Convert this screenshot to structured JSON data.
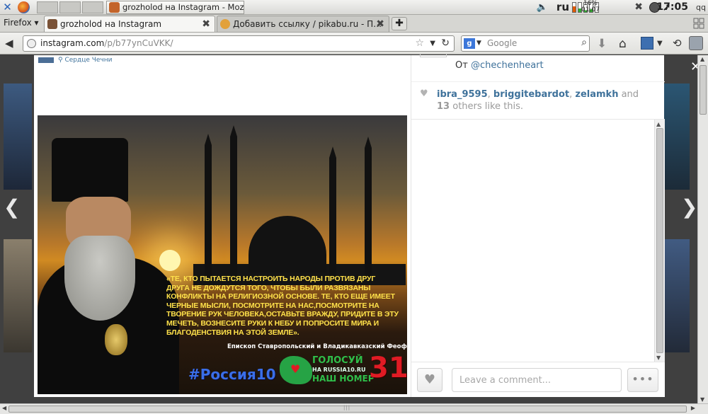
{
  "taskbar": {
    "active_task_title": "grozholod на Instagram - Mozi…",
    "keyboard_layout": "ru",
    "battery_percent": "16%",
    "battery_time": "01:07",
    "clock": "17:05",
    "user_label": "qq"
  },
  "browser": {
    "menu_label": "Firefox",
    "tabs": [
      {
        "title": "grozholod на Instagram",
        "active": true
      },
      {
        "title": "Добавить ссылку / pikabu.ru - П…",
        "active": false
      }
    ],
    "url_host": "instagram.com",
    "url_path": "/p/b77ynCuVKK/",
    "search_placeholder": "Google",
    "search_engine_icon": "google-icon"
  },
  "post": {
    "location": "Сердце Чечни",
    "image": {
      "quote": "«Те, кто пытается настроить народы против друг друга не дождутся того, чтобы были развязаны конфликты на религиозной основе. Те, кто еще имеет черные мысли, посмотрите на нас,посмотрите на творение рук человека,оставьте вражду, придите в эту мечеть, вознесите руки к небу и попросите мира и благоденствия на этой земле».",
      "author": "Епископ Ставропольский и Владикавказский Феофан",
      "hashtag": "#Россия10",
      "vote_line1": "ГОЛОСУЙ",
      "vote_line2": "НА RUSSIA10.RU",
      "vote_line3": "НАШ НОМЕР",
      "vote_number": "31"
    },
    "via_prefix": "От",
    "via_user": "@chechenheart",
    "likers": [
      "ibra_9595",
      "briggitebardot",
      "zelamkh"
    ],
    "likes_and": "and",
    "likes_count": "13",
    "likes_suffix": "others like this.",
    "comment_placeholder": "Leave a comment...",
    "more_label": "•••"
  }
}
